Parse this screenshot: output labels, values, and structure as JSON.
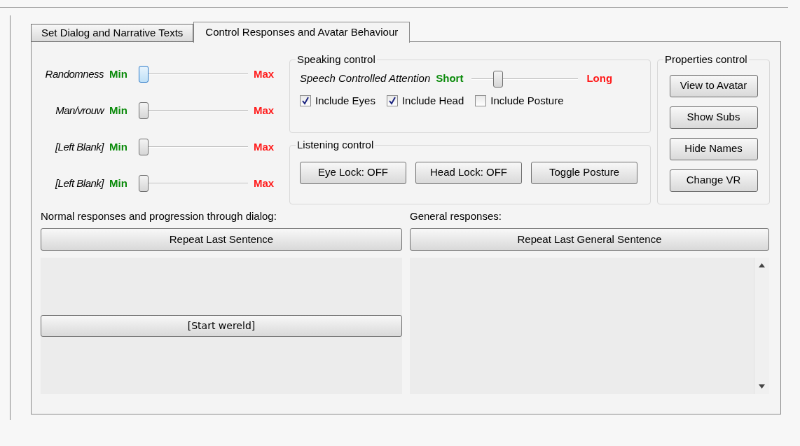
{
  "tabs": [
    {
      "label": "Set Dialog and Narrative Texts",
      "selected": false
    },
    {
      "label": "Control Responses and Avatar Behaviour",
      "selected": true
    }
  ],
  "sliders": [
    {
      "label": "Randomness",
      "min_label": "Min",
      "max_label": "Max",
      "level": 0,
      "focused": true
    },
    {
      "label": "Man/vrouw",
      "min_label": "Min",
      "max_label": "Max",
      "level": 0,
      "focused": false
    },
    {
      "label": "[Left Blank]",
      "min_label": "Min",
      "max_label": "Max",
      "level": 0,
      "focused": false
    },
    {
      "label": "[Left Blank]",
      "min_label": "Min",
      "max_label": "Max",
      "level": 0,
      "focused": false
    }
  ],
  "speaking_control": {
    "title": "Speaking control",
    "slider": {
      "label": "Speech Controlled Attention",
      "min_label": "Short",
      "max_label": "Long",
      "level": 0.22
    },
    "checkboxes": [
      {
        "label": "Include Eyes",
        "checked": true
      },
      {
        "label": "Include Head",
        "checked": true
      },
      {
        "label": "Include Posture",
        "checked": false
      }
    ]
  },
  "listening_control": {
    "title": "Listening control",
    "buttons": [
      "Eye Lock: OFF",
      "Head Lock: OFF",
      "Toggle Posture"
    ]
  },
  "properties_control": {
    "title": "Properties control",
    "buttons": [
      "View to Avatar",
      "Show Subs",
      "Hide  Names",
      "Change VR"
    ]
  },
  "normal_responses": {
    "label": "Normal responses and progression through dialog:",
    "button": "Repeat Last Sentence",
    "list_items": [
      "[Start wereld]"
    ]
  },
  "general_responses": {
    "label": "General responses:",
    "button": "Repeat Last General Sentence"
  }
}
